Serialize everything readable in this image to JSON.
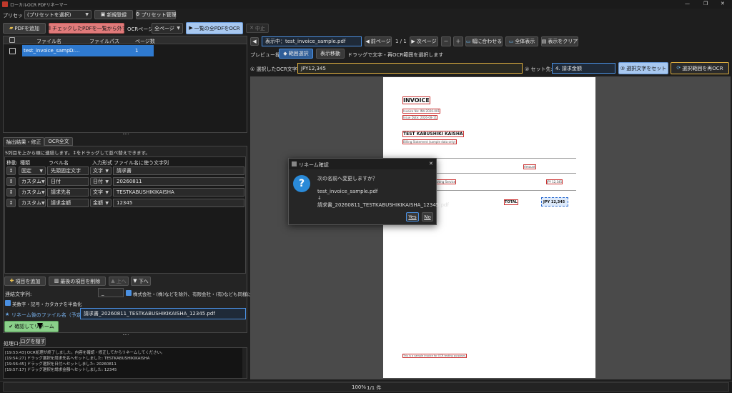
{
  "window": {
    "title": "ローカルOCR PDFリネーマー",
    "minimize": "—",
    "maximize": "❐",
    "close": "✕"
  },
  "preset": {
    "label": "プリセット:",
    "value": "(プリセットを選択)",
    "new": "新規登録",
    "manage": "プリセット管理"
  },
  "toolbar": {
    "add_pdf": "PDFを追加",
    "remove_checked": "チェックしたPDFを一覧から外す",
    "ocr_page_label": "OCRページ:",
    "ocr_page_value": "全ページ",
    "ocr_all": "一覧の全PDFをOCR",
    "stop": "中止"
  },
  "file_table": {
    "headers": [
      "ファイル名",
      "ファイルパス",
      "ページ数"
    ],
    "rows": [
      {
        "name": "test_invoice_samp...",
        "path": "D:...",
        "pages": "1"
      }
    ]
  },
  "tabs": {
    "extract": "抽出結果・修正",
    "ocr": "OCR全文"
  },
  "extract": {
    "hint": "5列目を上から順に連結します。↕をドラッグして並べ替えできます。",
    "headers": [
      "移動",
      "種類",
      "ラベル名",
      "入力形式",
      "ファイル名に使う文字列"
    ],
    "rows": [
      {
        "move": "↕",
        "kind": "固定",
        "label": "先頭固定文字",
        "format": "文字",
        "value": "請求書"
      },
      {
        "move": "↕",
        "kind": "カスタム",
        "label": "日付",
        "format": "日付",
        "value": "20260811"
      },
      {
        "move": "↕",
        "kind": "カスタム",
        "label": "請求先名",
        "format": "文字",
        "value": "TESTKABUSHIKIKAISHA"
      },
      {
        "move": "↕",
        "kind": "カスタム",
        "label": "請求金額",
        "format": "金額",
        "value": "12345"
      }
    ],
    "add_item": "項目を追加",
    "delete_last": "最後の項目を削除",
    "up": "上へ",
    "down": "下へ",
    "join_label": "連結文字列:",
    "join_value": "_",
    "remove_corp": "株式会社・(株)などを除外、有限会社・(有)なども同様に変換",
    "halfwidth": "英数字・記号・カタカナを半角化",
    "rename_label": "リネーム後のファイル名（予定）",
    "rename_value": "請求書_20260811_TESTKABUSHIKIKAISHA_12345.pdf",
    "confirm": "確認してリネーム"
  },
  "log": {
    "tab": "処理ログ",
    "hide": "ログを隠す",
    "lines": [
      "[19:53:43] OCR処理が終了しました。内容を確認・修正してからリネームしてください。",
      "[19:54:27] ドラッグ選択を請求先名へセットしました: TESTKABUSHIKIKAISHA",
      "[19:56:45] ドラッグ選択を日付へセットしました: 20260811",
      "[19:57:17] ドラッグ選択を請求金額へセットしました: 12345"
    ]
  },
  "viewer": {
    "showing": "表示中：test_invoice_sample.pdf",
    "prev": "前ページ",
    "page": "1 / 1",
    "next": "次ページ",
    "zoom_out": "－",
    "zoom_in": "＋",
    "fit_width": "幅に合わせる",
    "fit_all": "全体表示",
    "clear": "表示をクリア",
    "preview_label": "プレビュー操作:",
    "range_select": "範囲選択",
    "move": "表示移動",
    "drag_hint": "ドラッグで文字・再OCR範囲を選択します",
    "ocr_text_label": "① 選択したOCR文字:",
    "ocr_text_value": "JPY12,345",
    "set_target_label": "② セット先:",
    "set_target_value": "4. 請求金額",
    "set_text": "③ 選択文字をセット",
    "reocr": "選択範囲を再OCR"
  },
  "doc": {
    "title": "INVOICE",
    "line1": "Invoice No: INV-2026-001",
    "line2": "Issue Date: 2026-08-11",
    "company": "TEST KABUSHIKI KAISHA",
    "sub": "Billing Statement (sample data only)",
    "col_amount": "Amount",
    "item": "Consulting Service",
    "item_amount": "JPY 12,345",
    "total_label": "TOTAL",
    "total_value": "JPY 12,345",
    "footer": "This is a sample invoice for OCR testing purposes."
  },
  "dialog": {
    "title": "リネーム確認",
    "question": "次の名前へ変更しますか？",
    "old": "test_invoice_sample.pdf",
    "arrow": "↓",
    "new": "請求書_20260811_TESTKABUSHIKIKAISHA_12345.pdf",
    "yes": "Yes",
    "no": "No",
    "close": "✕"
  },
  "status": {
    "zoom": "100%",
    "count": "1/1 件"
  }
}
